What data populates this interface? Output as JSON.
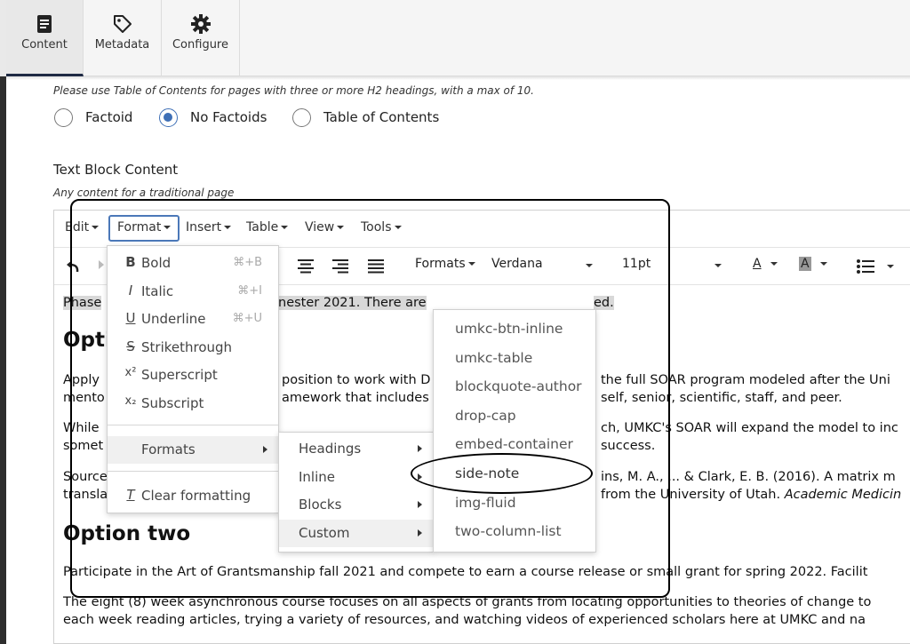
{
  "tabs": [
    {
      "label": "Content",
      "icon": "document-icon"
    },
    {
      "label": "Metadata",
      "icon": "tag-icon"
    },
    {
      "label": "Configure",
      "icon": "gear-icon"
    }
  ],
  "toc_help": "Please use Table of Contents for pages with three or more H2 headings, with a max of 10.",
  "radios": [
    {
      "label": "Factoid",
      "selected": false
    },
    {
      "label": "No Factoids",
      "selected": true
    },
    {
      "label": "Table of Contents",
      "selected": false
    }
  ],
  "field": {
    "label": "Text Block Content",
    "help": "Any content for a traditional page"
  },
  "menubar": [
    "Edit",
    "Format",
    "Insert",
    "Table",
    "View",
    "Tools"
  ],
  "toolbar": {
    "formats": "Formats",
    "font": "Verdana",
    "size": "11pt"
  },
  "content": {
    "p1a": "Phase",
    "p1b": "nester 2021. There are",
    "p1c": "ed.",
    "h_opt1": "Opti",
    "p2a": "Apply",
    "p2b": "position to work with D",
    "p2c": "the full SOAR program modeled after the Uni",
    "p2d": "mento",
    "p2e": "amework that includes",
    "p2f": "self, senior, scientific, staff, and peer.",
    "p3a": "While",
    "p3b": "ch, UMKC's SOAR will expand the model to inc",
    "p3c": "somet",
    "p3d": "success.",
    "p4a": "Source",
    "p4b": "ins, M. A., ... & Clark, E. B. (2016). A matrix m",
    "p4c": "transla",
    "p4d": "from the University of Utah. ",
    "p4e": "Academic Medicin",
    "h_opt2": "Option two",
    "p5": "Participate in the Art of Grantsmanship fall 2021 and compete to earn a course release or small grant for spring 2022. Facilit",
    "p6a": "The eight (8) week asynchronous course focuses on all aspects of grants from locating opportunities to theories of change to",
    "p6b": "each week reading articles, trying a variety of resources, and watching videos of experienced scholars here at UMKC and na"
  },
  "format_menu": [
    {
      "icon": "B",
      "label": "Bold",
      "shortcut": "⌘+B"
    },
    {
      "icon": "I",
      "label": "Italic",
      "shortcut": "⌘+I"
    },
    {
      "icon": "U",
      "label": "Underline",
      "shortcut": "⌘+U"
    },
    {
      "icon": "S",
      "label": "Strikethrough",
      "shortcut": ""
    },
    {
      "icon": "x²",
      "label": "Superscript",
      "shortcut": ""
    },
    {
      "icon": "x₂",
      "label": "Subscript",
      "shortcut": ""
    },
    {
      "icon": "",
      "label": "Formats",
      "shortcut": ""
    },
    {
      "icon": "T",
      "label": "Clear formatting",
      "shortcut": ""
    }
  ],
  "formats_submenu": [
    "Headings",
    "Inline",
    "Blocks",
    "Custom"
  ],
  "custom_submenu": [
    "umkc-btn-inline",
    "umkc-table",
    "blockquote-author",
    "drop-cap",
    "embed-container",
    "side-note",
    "img-fluid",
    "two-column-list"
  ]
}
